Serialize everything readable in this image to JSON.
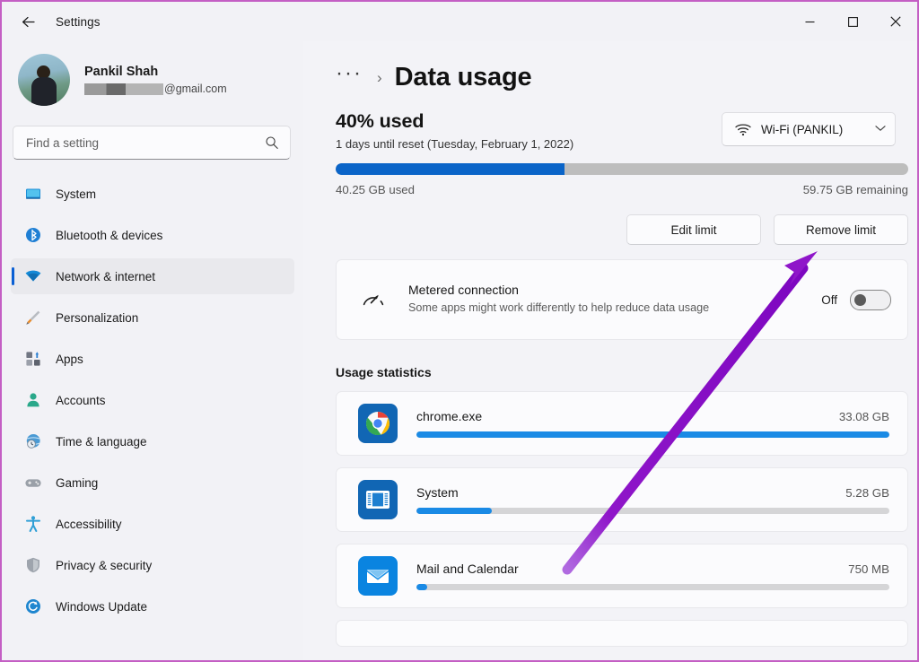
{
  "window": {
    "title": "Settings",
    "back_label": "back",
    "minimize_label": "Minimize",
    "maximize_label": "Maximize",
    "close_label": "Close"
  },
  "sidebar": {
    "account": {
      "name": "Pankil Shah",
      "email_suffix": "@gmail.com",
      "email_redacted": true
    },
    "search": {
      "placeholder": "Find a setting",
      "value": ""
    },
    "items": [
      {
        "label": "System",
        "icon": "monitor-icon",
        "active": false
      },
      {
        "label": "Bluetooth & devices",
        "icon": "bluetooth-icon",
        "active": false
      },
      {
        "label": "Network & internet",
        "icon": "wifi-icon",
        "active": true
      },
      {
        "label": "Personalization",
        "icon": "brush-icon",
        "active": false
      },
      {
        "label": "Apps",
        "icon": "apps-icon",
        "active": false
      },
      {
        "label": "Accounts",
        "icon": "person-icon",
        "active": false
      },
      {
        "label": "Time & language",
        "icon": "clock-globe-icon",
        "active": false
      },
      {
        "label": "Gaming",
        "icon": "gamepad-icon",
        "active": false
      },
      {
        "label": "Accessibility",
        "icon": "accessibility-icon",
        "active": false
      },
      {
        "label": "Privacy & security",
        "icon": "shield-icon",
        "active": false
      },
      {
        "label": "Windows Update",
        "icon": "update-icon",
        "active": false
      }
    ]
  },
  "main": {
    "breadcrumb": {
      "overflow": "···",
      "separator": "›",
      "title": "Data usage"
    },
    "usage": {
      "percent_label": "40% used",
      "percent_value": 40,
      "reset_note": "1 days until reset (Tuesday, February 1, 2022)",
      "used_label": "40.25 GB used",
      "remaining_label": "59.75 GB remaining",
      "used_gb": 40.25,
      "remaining_gb": 59.75,
      "total_gb": 100,
      "bar_color": "#0a64c8",
      "track_color": "#bdbdbd"
    },
    "adapter_select": {
      "label": "Wi-Fi (PANKIL)",
      "icon": "wifi-icon",
      "chevron": "⌄"
    },
    "buttons": {
      "edit_limit": "Edit limit",
      "remove_limit": "Remove limit"
    },
    "metered": {
      "icon": "speedometer-icon",
      "title": "Metered connection",
      "subtitle": "Some apps might work differently to help reduce data usage",
      "state_label": "Off",
      "enabled": false
    },
    "usage_statistics": {
      "heading": "Usage statistics",
      "apps": [
        {
          "name": "chrome.exe",
          "size": "33.08 GB",
          "percent": 100,
          "icon": "chrome-icon"
        },
        {
          "name": "System",
          "size": "5.28 GB",
          "percent": 16,
          "icon": "system-icon"
        },
        {
          "name": "Mail and Calendar",
          "size": "750 MB",
          "percent": 2.3,
          "icon": "mail-icon"
        }
      ]
    }
  },
  "annotation": {
    "type": "arrow",
    "color": "#8f16c9",
    "points_to": "remove-limit-button"
  }
}
